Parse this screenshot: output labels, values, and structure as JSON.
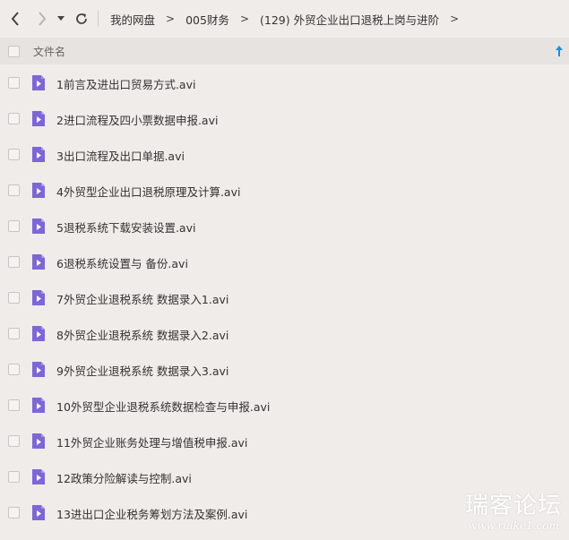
{
  "toolbar": {
    "back_icon": "chevron-left",
    "forward_icon": "chevron-right",
    "history_icon": "caret-down",
    "refresh_icon": "refresh"
  },
  "breadcrumb": {
    "items": [
      "我的网盘",
      "005财务",
      "(129) 外贸企业出口退税上岗与进阶"
    ],
    "separator": ">"
  },
  "header": {
    "column_name": "文件名",
    "sort_icon": "arrow-up",
    "sort_color": "#1a8ee6"
  },
  "file_icon_color": "#7b68d4",
  "files": [
    {
      "name": "1前言及进出口贸易方式.avi"
    },
    {
      "name": "2进口流程及四小票数据申报.avi"
    },
    {
      "name": "3出口流程及出口单据.avi"
    },
    {
      "name": "4外贸型企业出口退税原理及计算.avi"
    },
    {
      "name": "5退税系统下载安装设置.avi"
    },
    {
      "name": "6退税系统设置与 备份.avi"
    },
    {
      "name": "7外贸企业退税系统 数据录入1.avi"
    },
    {
      "name": "8外贸企业退税系统 数据录入2.avi"
    },
    {
      "name": "9外贸企业退税系统 数据录入3.avi"
    },
    {
      "name": "10外贸型企业退税系统数据检查与申报.avi"
    },
    {
      "name": "11外贸企业账务处理与增值税申报.avi"
    },
    {
      "name": "12政策分险解读与控制.avi"
    },
    {
      "name": "13进出口企业税务筹划方法及案例.avi"
    }
  ],
  "watermark": {
    "title": "瑞客论坛",
    "subtitle": "www.ruike1.com"
  }
}
